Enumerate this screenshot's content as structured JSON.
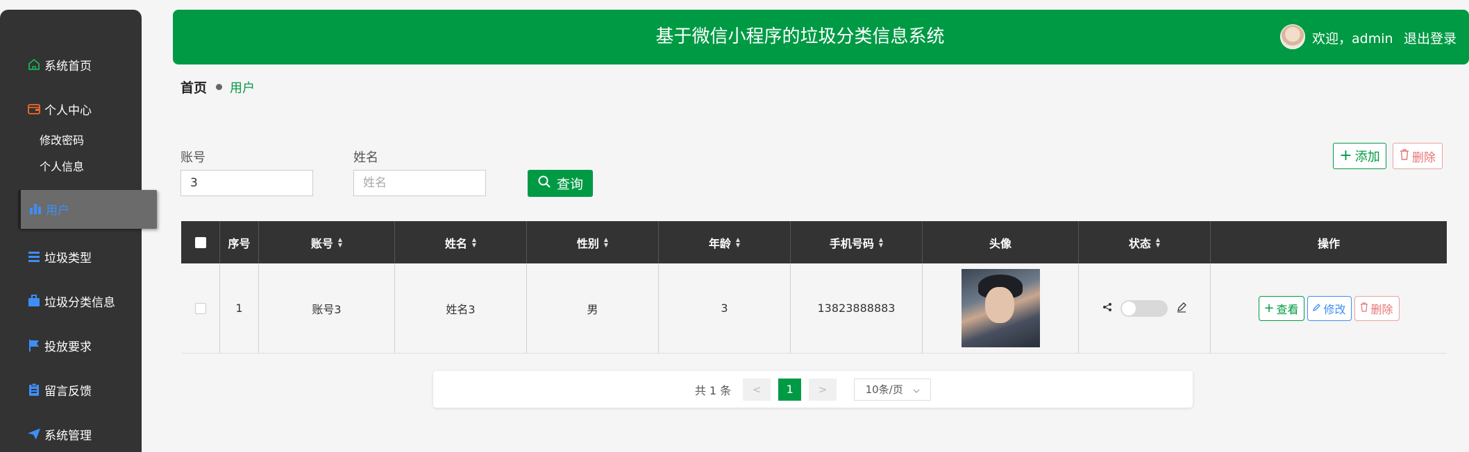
{
  "app": {
    "title": "基于微信小程序的垃圾分类信息系统",
    "welcome": "欢迎，admin",
    "logout": "退出登录"
  },
  "sidebar": {
    "items": [
      {
        "label": "系统首页",
        "icon": "home-icon"
      },
      {
        "label": "个人中心",
        "icon": "wallet-icon"
      },
      {
        "label": "修改密码"
      },
      {
        "label": "个人信息"
      },
      {
        "label": "用户",
        "icon": "bar-chart-icon",
        "active": true
      },
      {
        "label": "垃圾类型",
        "icon": "list-icon"
      },
      {
        "label": "垃圾分类信息",
        "icon": "briefcase-icon"
      },
      {
        "label": "投放要求",
        "icon": "flag-icon"
      },
      {
        "label": "留言反馈",
        "icon": "clipboard-icon"
      },
      {
        "label": "系统管理",
        "icon": "send-icon"
      }
    ]
  },
  "breadcrumb": {
    "home": "首页",
    "current": "用户"
  },
  "search": {
    "account_label": "账号",
    "account_value": "3",
    "name_label": "姓名",
    "name_placeholder": "姓名",
    "query_label": "查询"
  },
  "toolbar": {
    "add_label": "添加",
    "delete_label": "删除"
  },
  "table": {
    "headers": [
      "序号",
      "账号",
      "姓名",
      "性别",
      "年龄",
      "手机号码",
      "头像",
      "状态",
      "操作"
    ],
    "rows": [
      {
        "index": "1",
        "account": "账号3",
        "name": "姓名3",
        "gender": "男",
        "age": "3",
        "phone": "13823888883",
        "status_on": false
      }
    ],
    "actions": {
      "view": "查看",
      "edit": "修改",
      "delete": "删除"
    }
  },
  "pagination": {
    "total": "共 1 条",
    "prev": "<",
    "current": "1",
    "next": ">",
    "page_size": "10条/页"
  },
  "colors": {
    "primary": "#009a44",
    "sidebar": "#333333",
    "edit": "#3e8ef7",
    "danger": "#e87474"
  }
}
